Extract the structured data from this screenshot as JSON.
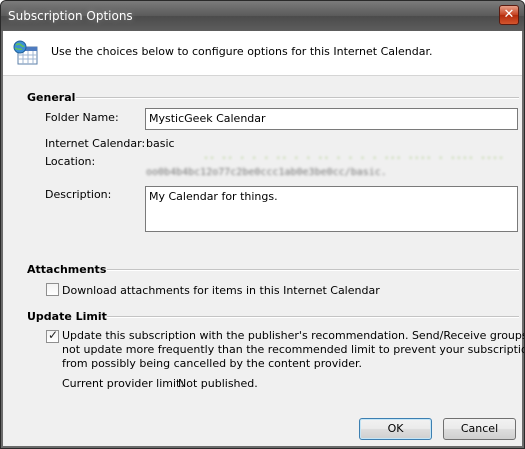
{
  "window": {
    "title": "Subscription Options",
    "close_glyph": "✕"
  },
  "header": {
    "icon": "internet-calendar-icon",
    "text": "Use the choices below to configure options for this Internet Calendar."
  },
  "general": {
    "title": "General",
    "folder_name_label": "Folder Name:",
    "folder_name_value": "MysticGeek Calendar",
    "internet_calendar_label": "Internet Calendar:",
    "internet_calendar_value": "basic",
    "location_label": "Location:",
    "location_line1": "·· ·· · · ·  ·· · · ·· · · · · ··· ···· · ···· ···· · · ·",
    "location_line2": "oo0b4b4bc12o77c2be0ccc1ab0e3be0cc/basic.ics",
    "description_label": "Description:",
    "description_value": "My Calendar for things."
  },
  "attachments": {
    "title": "Attachments",
    "download_label": "Download attachments for items in this Internet Calendar",
    "download_checked": false
  },
  "update_limit": {
    "title": "Update Limit",
    "update_label_line1": "Update this subscription with the publisher's recommendation. Send/Receive groups do",
    "update_label_line2": "not update more frequently than the recommended limit to prevent your subscription",
    "update_label_line3": "from possibly being cancelled by the content provider.",
    "update_checked": true,
    "check_glyph": "✓",
    "provider_limit_label": "Current provider limit:",
    "provider_limit_value": "Not published."
  },
  "buttons": {
    "ok": "OK",
    "cancel": "Cancel"
  },
  "colors": {
    "titlebar": "#5d5d5d",
    "close_button": "#c5401f",
    "dialog_bg": "#f0f0f0",
    "default_button_border": "#3c7fb1"
  }
}
